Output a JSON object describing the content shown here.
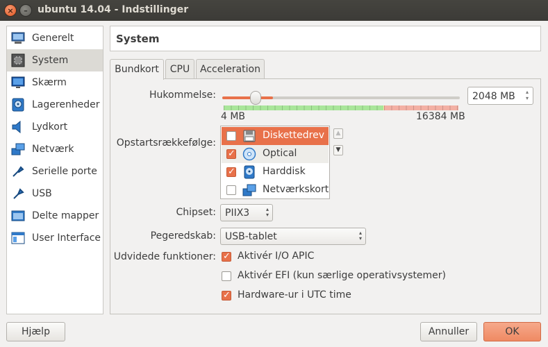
{
  "window": {
    "title": "ubuntu 14.04 - Indstillinger",
    "close_glyph": "×",
    "minimize_glyph": "–"
  },
  "sidebar": {
    "items": [
      {
        "label": "Generelt",
        "icon": "general-icon"
      },
      {
        "label": "System",
        "icon": "system-icon",
        "selected": true
      },
      {
        "label": "Skærm",
        "icon": "display-icon"
      },
      {
        "label": "Lagerenheder",
        "icon": "storage-icon"
      },
      {
        "label": "Lydkort",
        "icon": "audio-icon"
      },
      {
        "label": "Netværk",
        "icon": "network-icon"
      },
      {
        "label": "Serielle porte",
        "icon": "serial-ports-icon"
      },
      {
        "label": "USB",
        "icon": "usb-icon"
      },
      {
        "label": "Delte mapper",
        "icon": "shared-folders-icon"
      },
      {
        "label": "User Interface",
        "icon": "user-interface-icon"
      }
    ]
  },
  "header": {
    "title": "System"
  },
  "tabs": [
    {
      "label": "Bundkort",
      "active": true
    },
    {
      "label": "CPU",
      "active": false
    },
    {
      "label": "Acceleration",
      "active": false
    }
  ],
  "motherboard": {
    "memory": {
      "label": "Hukommelse:",
      "value": "2048 MB",
      "min_label": "4 MB",
      "max_label": "16384 MB",
      "fraction": 0.125
    },
    "boot_order": {
      "label": "Opstartsrækkefølge:",
      "items": [
        {
          "label": "Diskettedrev",
          "checked": false,
          "icon": "floppy-icon",
          "selected": true
        },
        {
          "label": "Optical",
          "checked": true,
          "icon": "optical-disc-icon"
        },
        {
          "label": "Harddisk",
          "checked": true,
          "icon": "hard-disk-icon"
        },
        {
          "label": "Netværkskort",
          "checked": false,
          "icon": "network-card-icon"
        }
      ],
      "up_glyph": "▲",
      "down_glyph": "▼"
    },
    "chipset": {
      "label": "Chipset:",
      "value": "PIIX3"
    },
    "pointing_device": {
      "label": "Pegeredskab:",
      "value": "USB-tablet"
    },
    "extended": {
      "label": "Udvidede funktioner:",
      "options": [
        {
          "label": "Aktivér I/O APIC",
          "checked": true
        },
        {
          "label": "Aktivér EFI (kun særlige operativsystemer)",
          "checked": false
        },
        {
          "label": "Hardware-ur i UTC time",
          "checked": true
        }
      ]
    }
  },
  "buttons": {
    "help": "Hjælp",
    "cancel": "Annuller",
    "ok": "OK"
  },
  "colors": {
    "accent": "#e8714a",
    "titlebar": "#3c3b37"
  }
}
